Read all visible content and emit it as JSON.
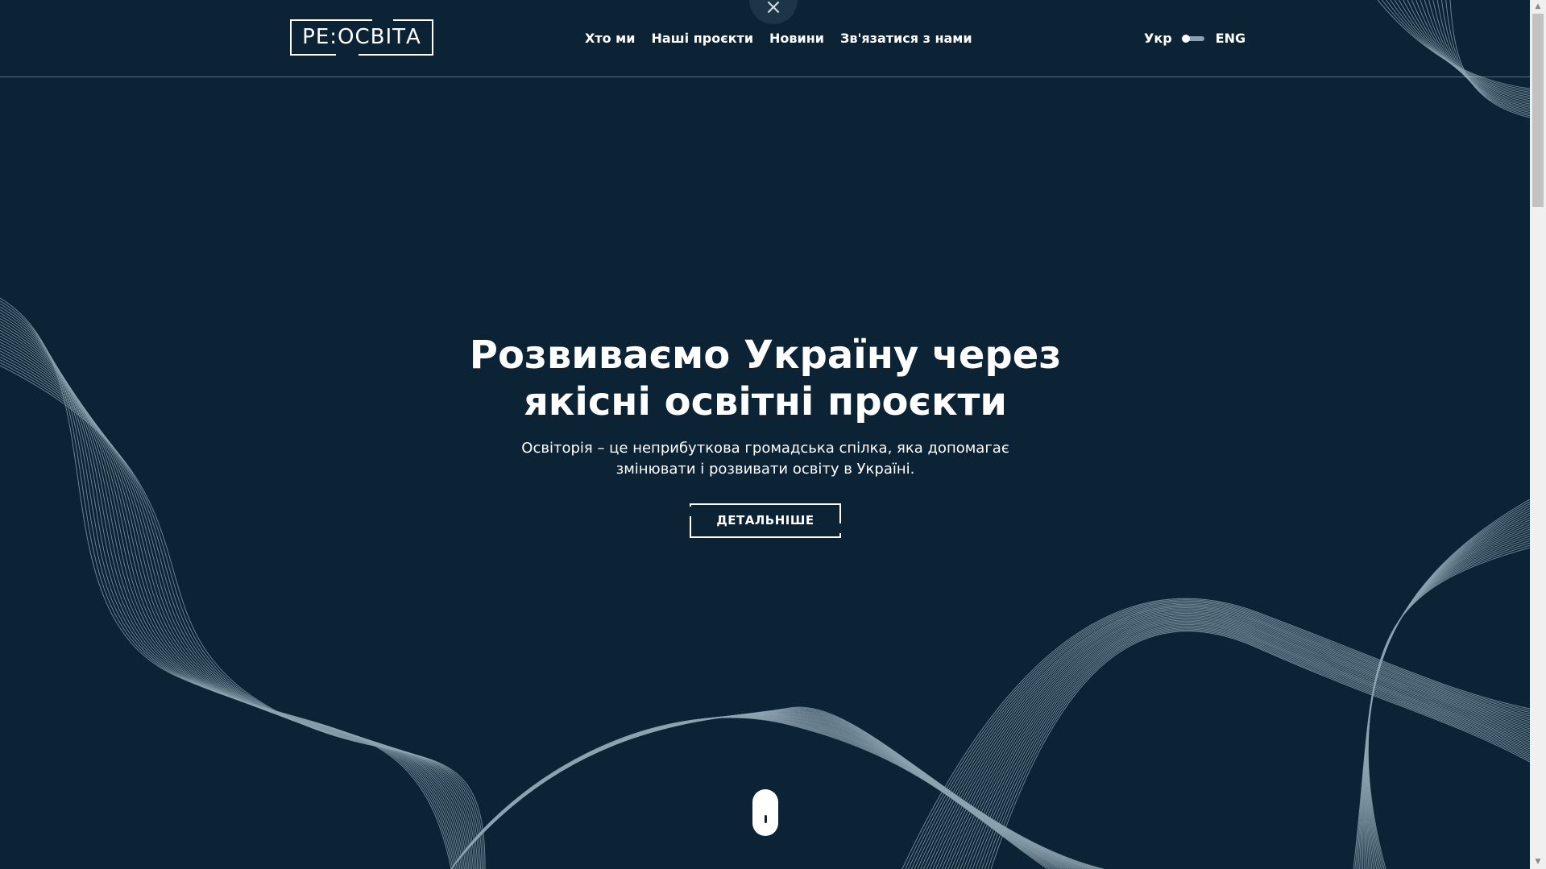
{
  "logo": {
    "text": "РЕ:ОСВІТА"
  },
  "header": {
    "nav": [
      {
        "label": "Хто ми"
      },
      {
        "label": "Наші проєкти"
      },
      {
        "label": "Новини"
      },
      {
        "label": "Зв'язатися з нами"
      }
    ],
    "close_icon": "×",
    "lang": {
      "ua": "Укр",
      "en": "ENG"
    }
  },
  "hero": {
    "title_line1": "Розвиваємо Україну через",
    "title_line2": "якісні освітні проєкти",
    "subtitle_line1": "Освіторія – це неприбуткова громадська спілка, яка допомагає",
    "subtitle_line2": "змінювати і розвивати освіту в Україні.",
    "cta_label": "ДЕТАЛЬНІШЕ"
  },
  "scrollbar": {
    "up": "▲",
    "down": "▼"
  },
  "colors": {
    "background": "#0b2335",
    "wave_lines": "#8fa4b2",
    "text": "#ffffff"
  }
}
